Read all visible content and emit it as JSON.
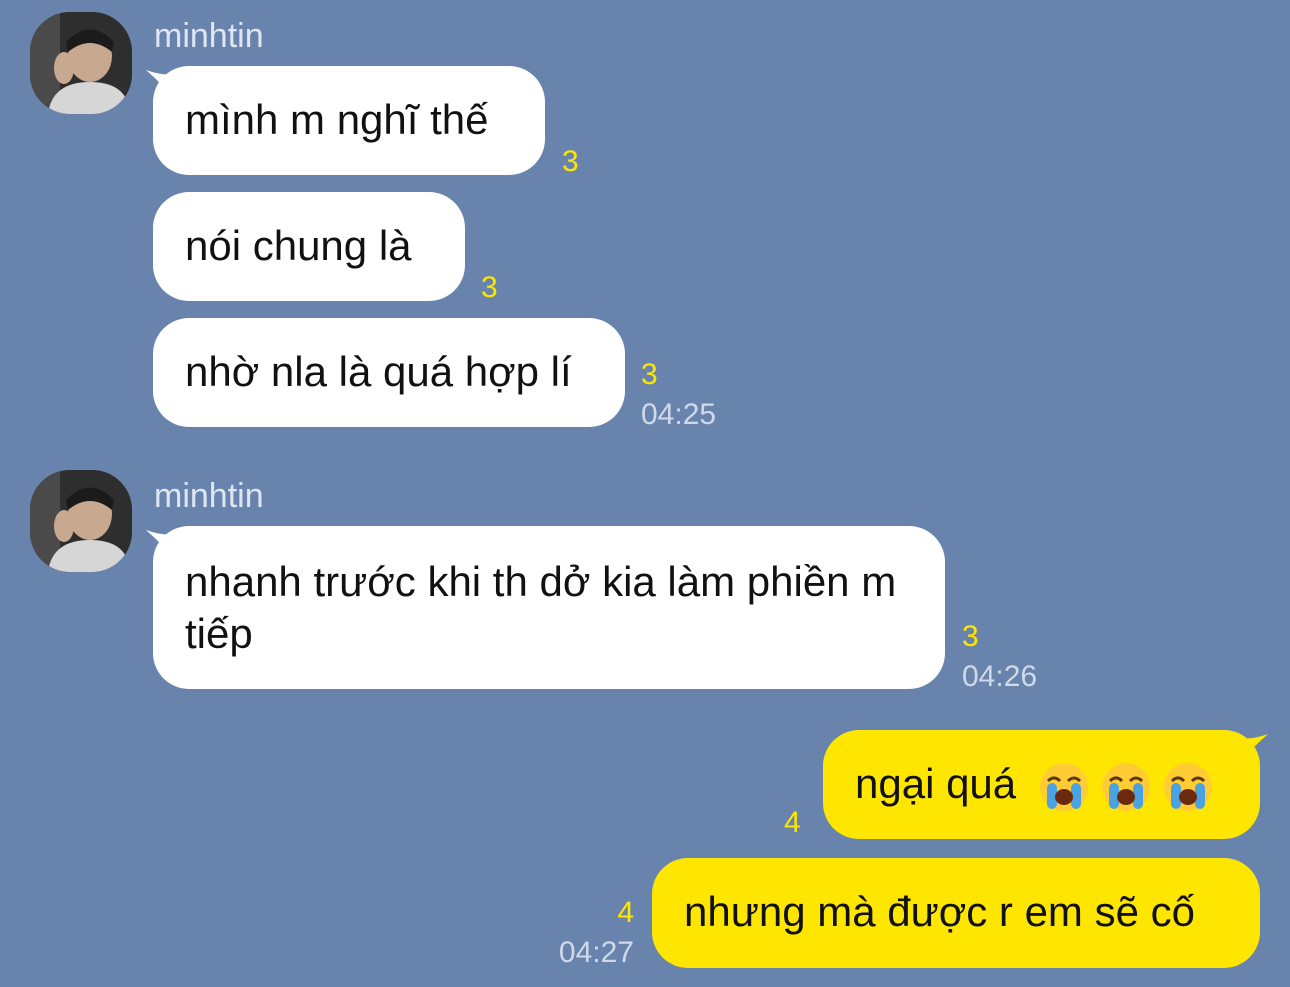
{
  "groups": [
    {
      "sender": "minhtin",
      "messages": [
        {
          "text": "mình m nghĩ thế",
          "count": "3",
          "time": ""
        },
        {
          "text": "nói chung là",
          "count": "3",
          "time": ""
        },
        {
          "text": "nhờ nla là quá hợp lí",
          "count": "3",
          "time": "04:25"
        }
      ]
    },
    {
      "sender": "minhtin",
      "messages": [
        {
          "text": "nhanh trước khi th dở kia làm phiền m tiếp",
          "count": "3",
          "time": "04:26"
        }
      ]
    }
  ],
  "mine": [
    {
      "text": "ngại quá",
      "emoji": [
        "loudly-crying-face",
        "loudly-crying-face",
        "loudly-crying-face"
      ],
      "count": "4",
      "time": ""
    },
    {
      "text": "nhưng mà được r em sẽ cố",
      "count": "4",
      "time": "04:27"
    }
  ],
  "colors": {
    "background": "#6884ad",
    "incoming_bubble": "#ffffff",
    "outgoing_bubble": "#ffe600",
    "read_count": "#ffe600"
  }
}
